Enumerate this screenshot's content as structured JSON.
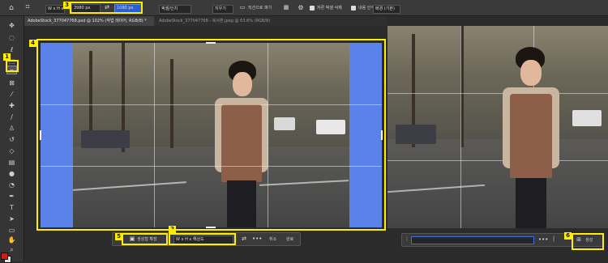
{
  "options_bar": {
    "ratio_select": "W x H x 해",
    "width_value": "3980 px",
    "swap_icon": "swap-arrows-icon",
    "height_value": "1080 px",
    "resolution_select": "픽셀/인치",
    "clear_button": "지우기",
    "straighten_label": "직선으로 펴기",
    "delete_pixels_checkbox": "자른 픽셀 삭제",
    "content_aware_label": "내용 인식",
    "extra_select": "배경 (기본)"
  },
  "tabs": [
    {
      "label": "AdobeStock_377047768.psd @ 102% (작업 레이어, RGB/8) *",
      "active": true
    },
    {
      "label": "AdobeStock_377047768 - 복사본.jpeg @ 63.6% (RGB/8)",
      "active": false
    }
  ],
  "annotations": [
    "1",
    "2",
    "3",
    "4",
    "5",
    "6"
  ],
  "taskbar_left": {
    "frame_button": "생성형 확장",
    "ratio_select": "W x H x 해상도",
    "more_icon": "more-dots-icon",
    "cancel": "취소",
    "done": "완료"
  },
  "taskbar_right": {
    "prompt_placeholder": "",
    "more_icon": "more-dots-icon",
    "generate_button": "생성"
  },
  "colors": {
    "annotation_yellow": "#ffee00",
    "fill_blue": "#5a82e8",
    "panel_bg": "#3a3a3a",
    "workspace_bg": "#2b2b2b"
  }
}
